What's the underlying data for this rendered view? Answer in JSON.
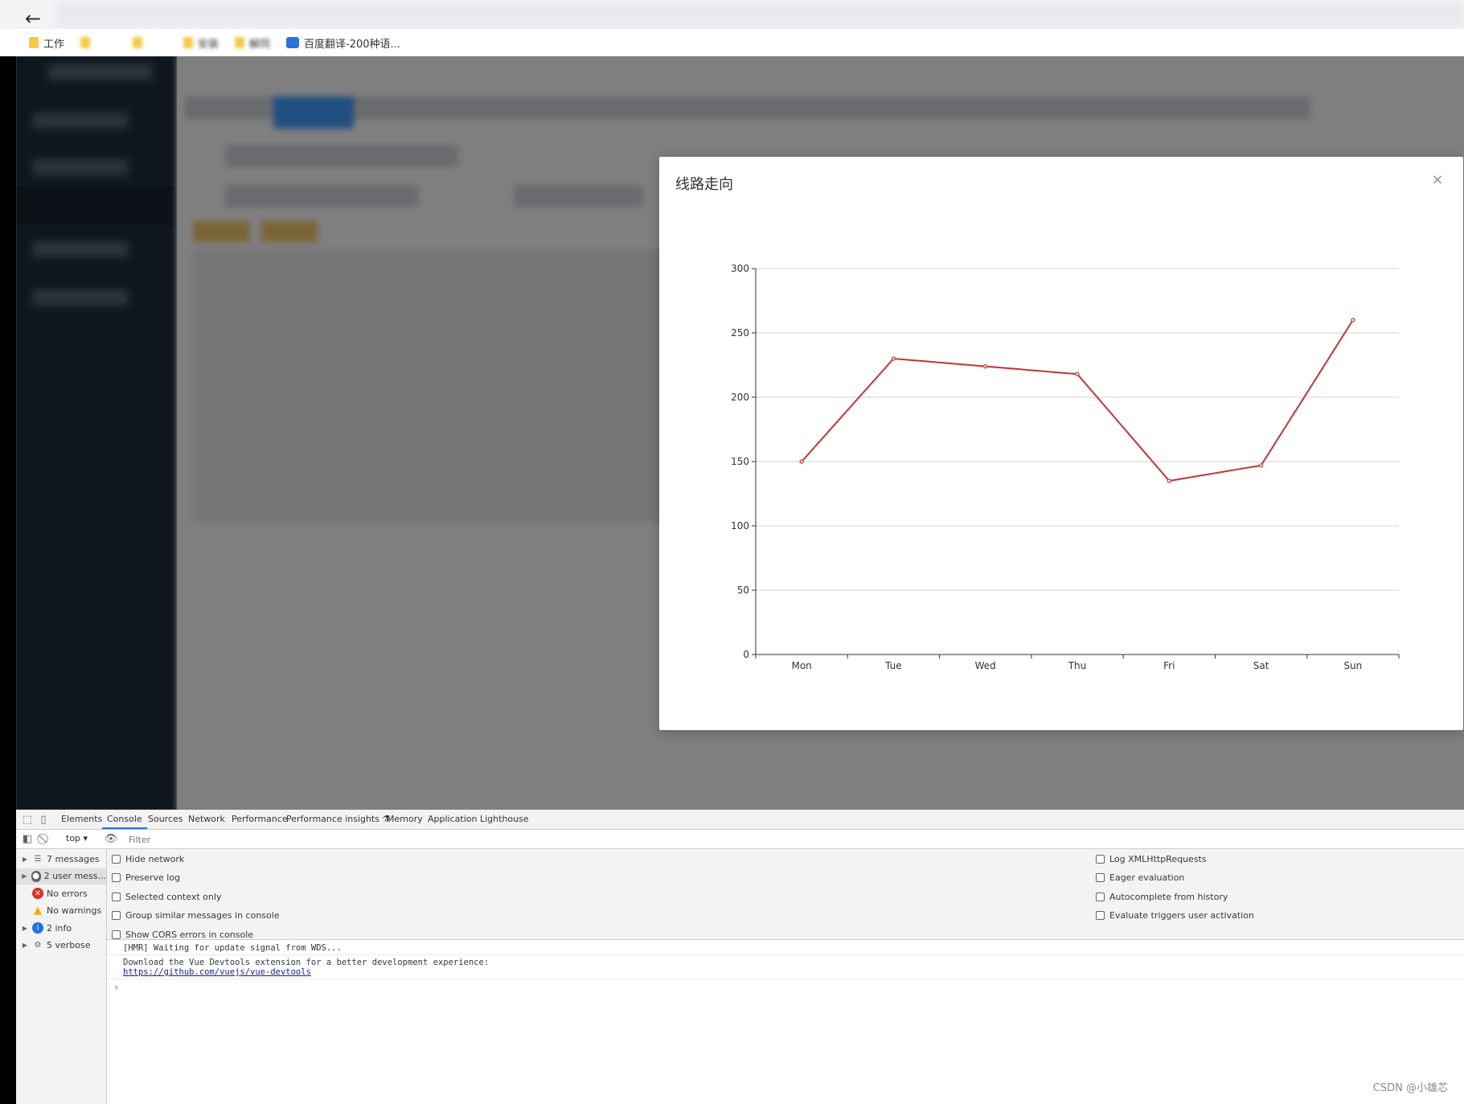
{
  "browser": {
    "bookmarks": [
      {
        "label": "工作"
      },
      {
        "label": "安装"
      },
      {
        "label": "解同"
      },
      {
        "label": "百度翻译-200种语..."
      }
    ]
  },
  "modal": {
    "title": "线路走向",
    "close_icon": "×"
  },
  "chart_data": {
    "type": "line",
    "categories": [
      "Mon",
      "Tue",
      "Wed",
      "Thu",
      "Fri",
      "Sat",
      "Sun"
    ],
    "series": [
      {
        "values": [
          150,
          230,
          224,
          218,
          135,
          147,
          260
        ],
        "color": "#c23531"
      }
    ],
    "ylim": [
      0,
      300
    ],
    "yticks": [
      0,
      50,
      100,
      150,
      200,
      250,
      300
    ],
    "grid": true,
    "title": "",
    "xlabel": "",
    "ylabel": ""
  },
  "devtools": {
    "tabs": [
      {
        "label": "Elements"
      },
      {
        "label": "Console",
        "active": true
      },
      {
        "label": "Sources"
      },
      {
        "label": "Network"
      },
      {
        "label": "Performance"
      },
      {
        "label": "Performance insights ⚗"
      },
      {
        "label": "Memory"
      },
      {
        "label": "Application"
      },
      {
        "label": "Lighthouse"
      }
    ],
    "context": "top ▾",
    "filter_placeholder": "Filter",
    "sidebar": [
      {
        "label": "7 messages",
        "icon": "list-icon"
      },
      {
        "label": "2 user mess...",
        "icon": "user-icon"
      },
      {
        "label": "No errors",
        "icon": "error-icon"
      },
      {
        "label": "No warnings",
        "icon": "warning-icon"
      },
      {
        "label": "2 info",
        "icon": "info-icon"
      },
      {
        "label": "5 verbose",
        "icon": "verbose-icon"
      }
    ],
    "settings_left": [
      "Hide network",
      "Preserve log",
      "Selected context only",
      "Group similar messages in console",
      "Show CORS errors in console"
    ],
    "settings_right": [
      "Log XMLHttpRequests",
      "Eager evaluation",
      "Autocomplete from history",
      "Evaluate triggers user activation"
    ],
    "console_lines": [
      "[HMR] Waiting for update signal from WDS...",
      "Download the Vue Devtools extension for a better development experience:"
    ],
    "console_link": "https://github.com/vuejs/vue-devtools",
    "prompt": "›"
  },
  "watermark": "CSDN @小雄芯"
}
